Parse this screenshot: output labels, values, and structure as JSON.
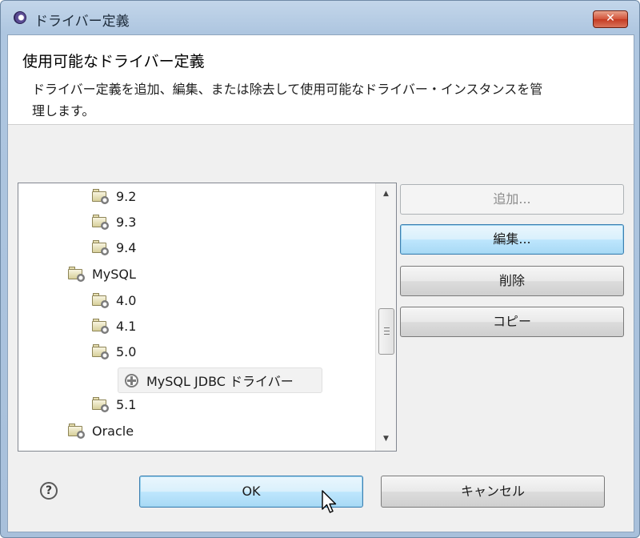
{
  "window": {
    "title": "ドライバー定義",
    "close_glyph": "✕"
  },
  "header": {
    "title": "使用可能なドライバー定義",
    "description": "ドライバー定義を追加、編集、または除去して使用可能なドライバー・インスタンスを管理します。"
  },
  "tree": {
    "items": [
      {
        "label": "9.2",
        "level": 2
      },
      {
        "label": "9.3",
        "level": 2
      },
      {
        "label": "9.4",
        "level": 2
      },
      {
        "label": "MySQL",
        "level": 1
      },
      {
        "label": "4.0",
        "level": 2
      },
      {
        "label": "4.1",
        "level": 2
      },
      {
        "label": "5.0",
        "level": 2
      },
      {
        "label": "MySQL JDBC ドライバー",
        "level": 3,
        "selected": true
      },
      {
        "label": "5.1",
        "level": 2
      },
      {
        "label": "Oracle",
        "level": 1
      }
    ],
    "icons": {
      "folder": "folder-icon",
      "driver": "gear-icon"
    },
    "scroll_up_glyph": "▲",
    "scroll_down_glyph": "▼"
  },
  "actions": {
    "add": "追加...",
    "edit": "編集...",
    "delete": "削除",
    "copy": "コピー"
  },
  "footer": {
    "help_glyph": "?",
    "ok": "OK",
    "cancel": "キャンセル"
  },
  "colors": {
    "frame": "#aec6e0",
    "focus_accent": "#3c7fb1",
    "close_button": "#c43b22"
  }
}
